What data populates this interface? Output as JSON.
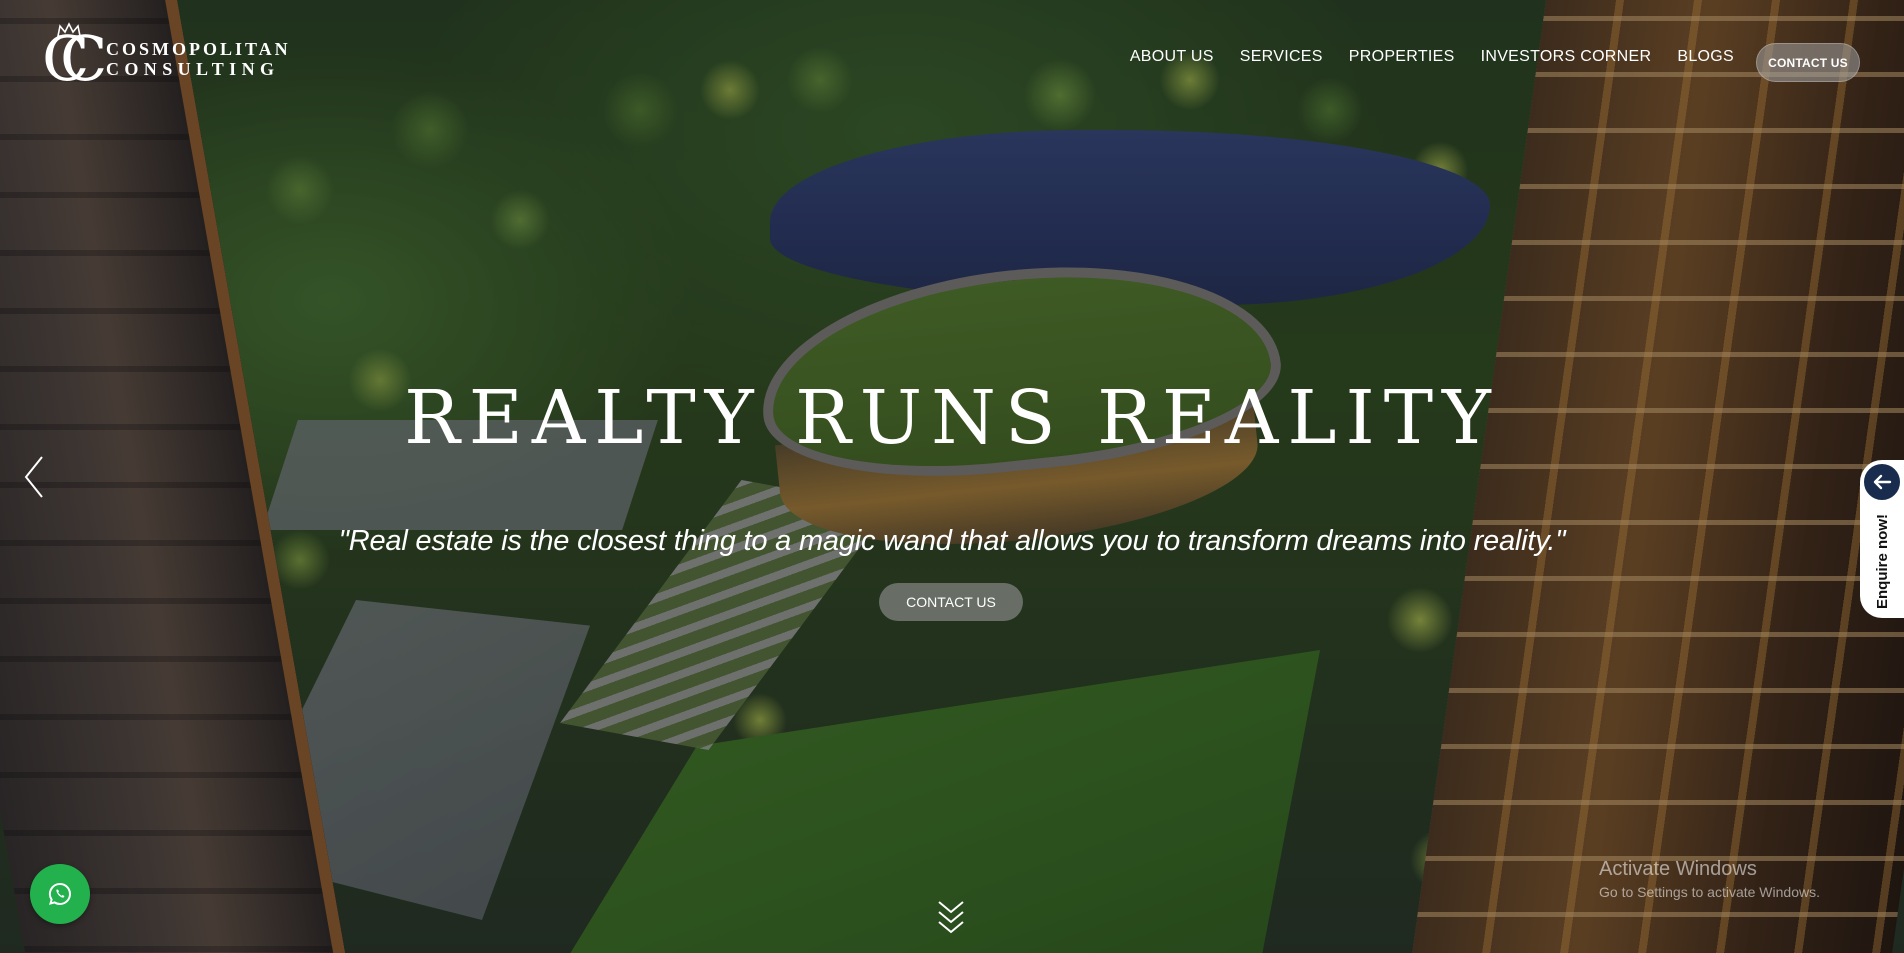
{
  "brand": {
    "line1": "COSMOPOLITAN",
    "line2": "CONSULTING",
    "monogram": "CC"
  },
  "nav": {
    "items": [
      "ABOUT US",
      "SERVICES",
      "PROPERTIES",
      "INVESTORS CORNER",
      "BLOGS"
    ],
    "contact_label": "CONTACT US"
  },
  "hero": {
    "title": "REALTY RUNS REALITY",
    "quote": "\"Real estate is the closest thing to a magic wand that allows you to transform dreams into reality.\"",
    "cta_label": "CONTACT US"
  },
  "enquire": {
    "label": "Enquire now!"
  },
  "icons": {
    "slider_prev": "chevron-left-icon",
    "scroll_down": "double-chevron-down-icon",
    "enquire": "arrow-left-icon",
    "whatsapp": "whatsapp-icon"
  },
  "watermark": {
    "title": "Activate Windows",
    "subtitle": "Go to Settings to activate Windows."
  },
  "colors": {
    "whatsapp": "#23b14d",
    "enquire_button": "#1a2c4e"
  }
}
